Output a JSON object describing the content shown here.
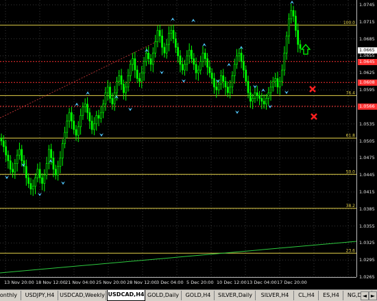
{
  "chart": {
    "symbol": "USDCAD",
    "timeframe": "H4",
    "background": "#000000",
    "candle_color": "#00ff00",
    "fractal_color": "#4fc3f7",
    "current_price": "1.0665",
    "price_labels": [
      "1.0745",
      "1.0715",
      "1.0685",
      "1.0655",
      "1.0625",
      "1.0595",
      "1.0565",
      "1.0535",
      "1.0505",
      "1.0475",
      "1.0445",
      "1.0415",
      "1.0385",
      "1.0355",
      "1.0325",
      "1.0295",
      "1.0265"
    ],
    "time_labels": [
      "13 Nov 20:00",
      "18 Nov 12:00",
      "21 Nov 04:00",
      "25 Nov 20:00",
      "28 Nov 12:00",
      "3 Dec 04:00",
      "5 Dec 20:00",
      "10 Dec 12:00",
      "13 Dec 04:00",
      "17 Dec 20:00"
    ],
    "fib_levels": [
      {
        "label": "100.0",
        "price": 1.0709,
        "color": "#e6d34a"
      },
      {
        "label": "76.4",
        "price": 1.0585,
        "color": "#e6d34a"
      },
      {
        "label": "61.8",
        "price": 1.051,
        "color": "#e6d34a"
      },
      {
        "label": "50.0",
        "price": 1.0446,
        "color": "#e6d34a"
      },
      {
        "label": "38.2",
        "price": 1.0386,
        "color": "#e6d34a"
      },
      {
        "label": "23.6",
        "price": 1.0307,
        "color": "#e6d34a"
      }
    ],
    "red_levels": [
      {
        "label": "1.0645",
        "price": 1.0645,
        "color": "#ff3030"
      },
      {
        "label": "1.0608",
        "price": 1.0608,
        "color": "#ff3030"
      },
      {
        "label": "1.0566",
        "price": 1.0566,
        "color": "#ff3030"
      }
    ],
    "markers": {
      "up_arrow": "up-arrow-icon",
      "cross_1": "x-mark-icon",
      "cross_2": "x-mark-icon"
    }
  },
  "tabs": [
    {
      "label": "Monthly",
      "active": false
    },
    {
      "label": "USDJPY,H4",
      "active": false
    },
    {
      "label": "USDCAD,Weekly",
      "active": false
    },
    {
      "label": "USDCAD,H4",
      "active": true
    },
    {
      "label": "GOLD,Daily",
      "active": false
    },
    {
      "label": "GOLD,H4",
      "active": false
    },
    {
      "label": "SILVER,Daily",
      "active": false
    },
    {
      "label": "SILVER,H4",
      "active": false
    },
    {
      "label": "CL,H4",
      "active": false
    },
    {
      "label": "ES,H4",
      "active": false
    },
    {
      "label": "NG,Dail",
      "active": false
    }
  ],
  "nav": {
    "left": "◄",
    "right": "►"
  }
}
